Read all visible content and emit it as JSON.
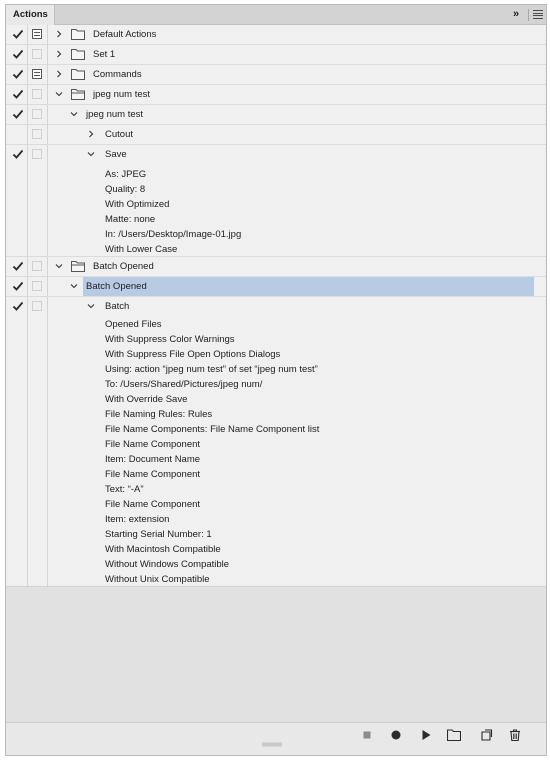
{
  "panel": {
    "tab_label": "Actions",
    "collapse_glyph": "»"
  },
  "rows": [
    {
      "label": "Default Actions"
    },
    {
      "label": "Set 1"
    },
    {
      "label": "Commands"
    },
    {
      "label": "jpeg num test"
    },
    {
      "label": "jpeg num test"
    },
    {
      "label": "Cutout"
    },
    {
      "label": "Save"
    },
    {
      "label": "Batch Opened"
    },
    {
      "label": "Batch Opened"
    },
    {
      "label": "Batch"
    }
  ],
  "save_details": [
    "As: JPEG",
    "Quality: 8",
    "With Optimized",
    "Matte: none",
    "In: /Users/Desktop/Image-01.jpg",
    "With Lower Case"
  ],
  "batch_details": [
    "Opened Files",
    "With Suppress Color Warnings",
    "With Suppress File Open Options Dialogs",
    "Using: action “jpeg num test” of set “jpeg num test”",
    "To: /Users/Shared/Pictures/jpeg num/",
    "With Override Save",
    "File Naming Rules: Rules",
    "File Name Components: File Name Component list",
    "File Name Component",
    "Item: Document Name",
    "File Name Component",
    "Text:  “-A”",
    "File Name Component",
    "Item: extension",
    "Starting Serial Number: 1",
    "With Macintosh Compatible",
    "Without Windows Compatible",
    "Without Unix Compatible"
  ],
  "colors": {
    "selection": "#b7cce4",
    "panel_bg": "#f0f0f0"
  },
  "icons": {
    "check": "check-icon",
    "folder": "folder-icon",
    "chevron_right": "chevron-right-icon",
    "chevron_down": "chevron-down-icon",
    "stop": "stop-icon",
    "record": "record-icon",
    "play": "play-icon",
    "new_set": "folder-icon",
    "new_action": "new-item-icon",
    "delete": "trash-icon"
  }
}
